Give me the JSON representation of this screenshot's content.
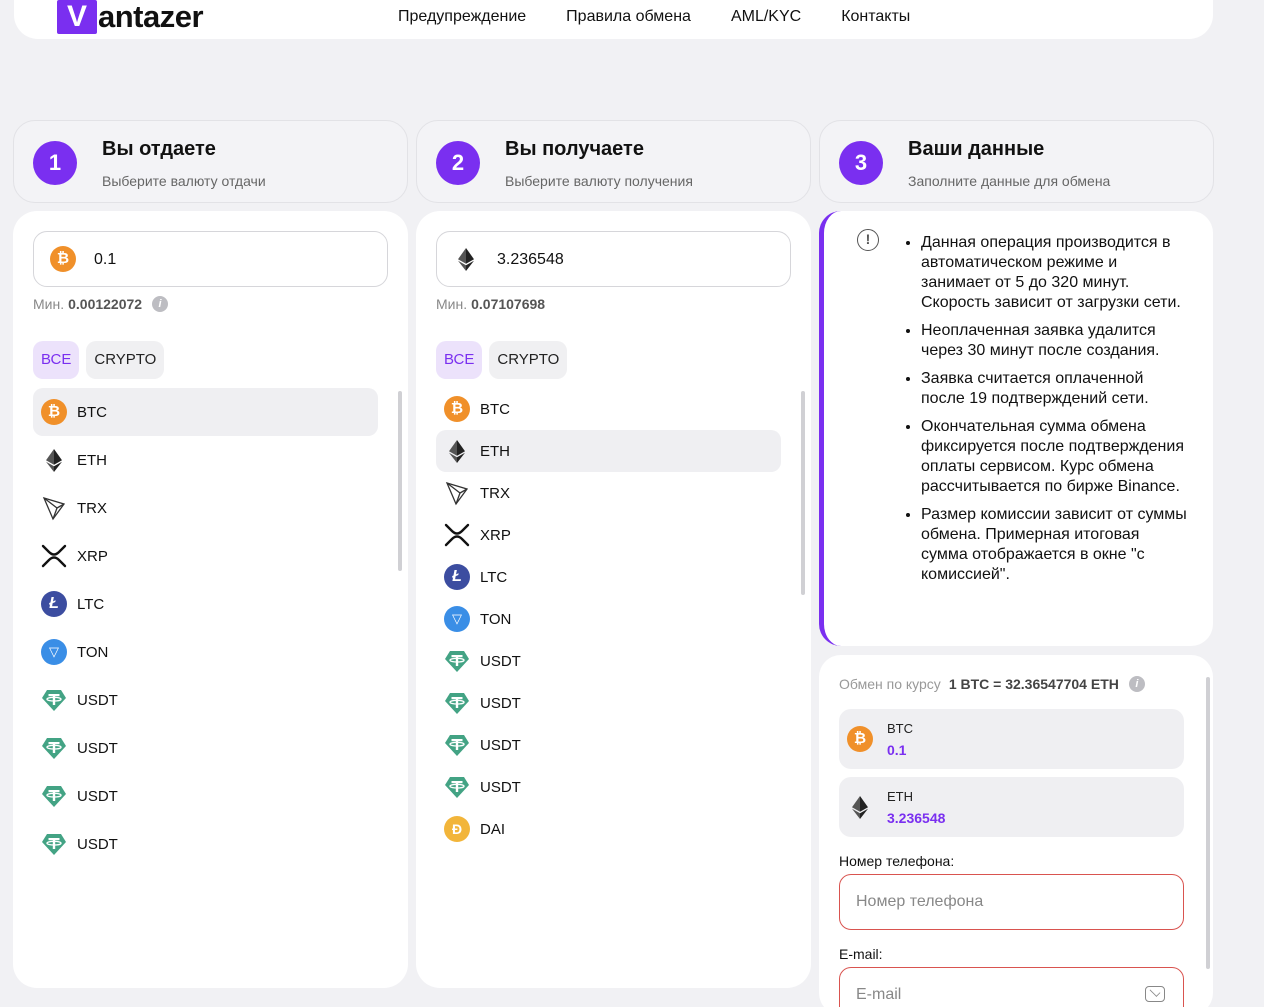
{
  "header": {
    "logo_letter": "V",
    "logo_rest": "antazer",
    "nav": [
      "Предупреждение",
      "Правила обмена",
      "AML/KYC",
      "Контакты"
    ]
  },
  "steps": [
    {
      "num": "1",
      "title": "Вы отдаете",
      "subtitle": "Выберите валюту отдачи"
    },
    {
      "num": "2",
      "title": "Вы получаете",
      "subtitle": "Выберите валюту получения"
    },
    {
      "num": "3",
      "title": "Ваши данные",
      "subtitle": "Заполните данные для обмена"
    }
  ],
  "give": {
    "amount": "0.1",
    "min_label": "Мин.",
    "min_value": "0.00122072",
    "filters": [
      "ВСЕ",
      "CRYPTO"
    ],
    "currencies": [
      {
        "ticker": "BTC",
        "icon": "btc-icon",
        "selected": true
      },
      {
        "ticker": "ETH",
        "icon": "eth-icon"
      },
      {
        "ticker": "TRX",
        "icon": "trx-icon"
      },
      {
        "ticker": "XRP",
        "icon": "xrp-icon"
      },
      {
        "ticker": "LTC",
        "icon": "ltc-icon"
      },
      {
        "ticker": "TON",
        "icon": "ton-icon"
      },
      {
        "ticker": "USDT",
        "icon": "usdt-icon"
      },
      {
        "ticker": "USDT",
        "icon": "usdt-icon"
      },
      {
        "ticker": "USDT",
        "icon": "usdt-icon"
      },
      {
        "ticker": "USDT",
        "icon": "usdt-icon"
      }
    ]
  },
  "receive": {
    "amount": "3.236548",
    "min_label": "Мин.",
    "min_value": "0.07107698",
    "filters": [
      "ВСЕ",
      "CRYPTO"
    ],
    "currencies": [
      {
        "ticker": "BTC",
        "icon": "btc-icon"
      },
      {
        "ticker": "ETH",
        "icon": "eth-icon",
        "selected": true
      },
      {
        "ticker": "TRX",
        "icon": "trx-icon"
      },
      {
        "ticker": "XRP",
        "icon": "xrp-icon"
      },
      {
        "ticker": "LTC",
        "icon": "ltc-icon"
      },
      {
        "ticker": "TON",
        "icon": "ton-icon"
      },
      {
        "ticker": "USDT",
        "icon": "usdt-icon"
      },
      {
        "ticker": "USDT",
        "icon": "usdt-icon"
      },
      {
        "ticker": "USDT",
        "icon": "usdt-icon"
      },
      {
        "ticker": "USDT",
        "icon": "usdt-icon"
      },
      {
        "ticker": "DAI",
        "icon": "dai-icon"
      }
    ]
  },
  "notice": {
    "icon": "exclamation-circle-icon",
    "items": [
      "Данная операция производится в автоматическом режиме и занимает от 5 до 320 минут. Скорость зависит от загрузки сети.",
      "Неоплаченная заявка удалится через 30 минут после создания.",
      "Заявка считается оплаченной после 19 подтверждений сети.",
      "Окончательная сумма обмена фиксируется после подтверждения оплаты сервисом. Курс обмена рассчитывается по бирже Binance.",
      "Размер комиссии зависит от суммы обмена. Примерная итоговая сумма отображается в окне \"с комиссией\"."
    ]
  },
  "summary": {
    "rate_label": "Обмен по курсу",
    "rate_value": "1 BTC = 32.36547704 ETH",
    "give": {
      "ticker": "BTC",
      "amount": "0.1"
    },
    "receive": {
      "ticker": "ETH",
      "amount": "3.236548"
    },
    "phone_label": "Номер телефона:",
    "phone_placeholder": "Номер телефона",
    "email_label": "E-mail:",
    "email_placeholder": "E-mail"
  },
  "colors": {
    "accent": "#7a2ff0",
    "error": "#d9534f"
  }
}
